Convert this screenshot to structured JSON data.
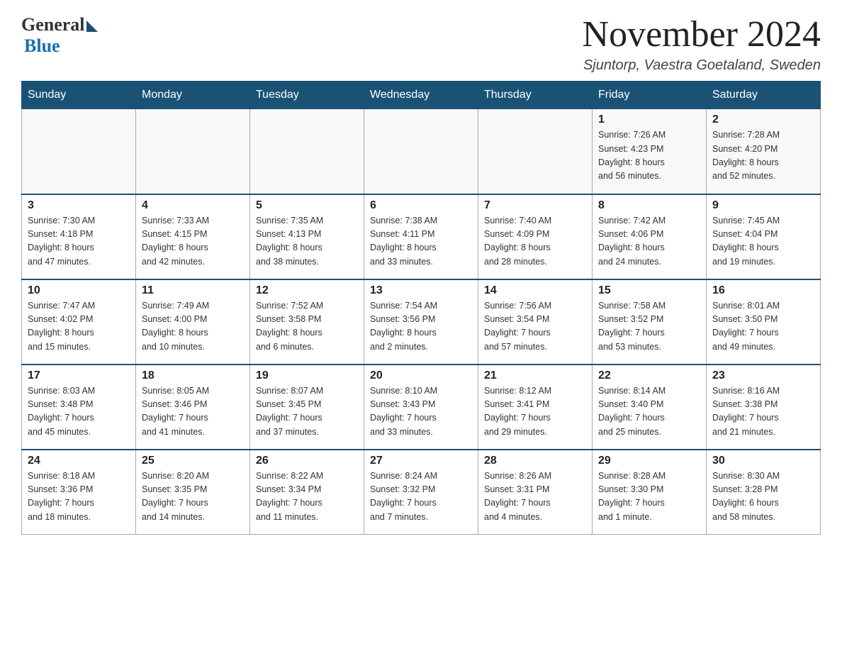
{
  "logo": {
    "general": "General",
    "blue": "Blue"
  },
  "title": "November 2024",
  "location": "Sjuntorp, Vaestra Goetaland, Sweden",
  "days_of_week": [
    "Sunday",
    "Monday",
    "Tuesday",
    "Wednesday",
    "Thursday",
    "Friday",
    "Saturday"
  ],
  "weeks": [
    [
      {
        "day": "",
        "info": ""
      },
      {
        "day": "",
        "info": ""
      },
      {
        "day": "",
        "info": ""
      },
      {
        "day": "",
        "info": ""
      },
      {
        "day": "",
        "info": ""
      },
      {
        "day": "1",
        "info": "Sunrise: 7:26 AM\nSunset: 4:23 PM\nDaylight: 8 hours\nand 56 minutes."
      },
      {
        "day": "2",
        "info": "Sunrise: 7:28 AM\nSunset: 4:20 PM\nDaylight: 8 hours\nand 52 minutes."
      }
    ],
    [
      {
        "day": "3",
        "info": "Sunrise: 7:30 AM\nSunset: 4:18 PM\nDaylight: 8 hours\nand 47 minutes."
      },
      {
        "day": "4",
        "info": "Sunrise: 7:33 AM\nSunset: 4:15 PM\nDaylight: 8 hours\nand 42 minutes."
      },
      {
        "day": "5",
        "info": "Sunrise: 7:35 AM\nSunset: 4:13 PM\nDaylight: 8 hours\nand 38 minutes."
      },
      {
        "day": "6",
        "info": "Sunrise: 7:38 AM\nSunset: 4:11 PM\nDaylight: 8 hours\nand 33 minutes."
      },
      {
        "day": "7",
        "info": "Sunrise: 7:40 AM\nSunset: 4:09 PM\nDaylight: 8 hours\nand 28 minutes."
      },
      {
        "day": "8",
        "info": "Sunrise: 7:42 AM\nSunset: 4:06 PM\nDaylight: 8 hours\nand 24 minutes."
      },
      {
        "day": "9",
        "info": "Sunrise: 7:45 AM\nSunset: 4:04 PM\nDaylight: 8 hours\nand 19 minutes."
      }
    ],
    [
      {
        "day": "10",
        "info": "Sunrise: 7:47 AM\nSunset: 4:02 PM\nDaylight: 8 hours\nand 15 minutes."
      },
      {
        "day": "11",
        "info": "Sunrise: 7:49 AM\nSunset: 4:00 PM\nDaylight: 8 hours\nand 10 minutes."
      },
      {
        "day": "12",
        "info": "Sunrise: 7:52 AM\nSunset: 3:58 PM\nDaylight: 8 hours\nand 6 minutes."
      },
      {
        "day": "13",
        "info": "Sunrise: 7:54 AM\nSunset: 3:56 PM\nDaylight: 8 hours\nand 2 minutes."
      },
      {
        "day": "14",
        "info": "Sunrise: 7:56 AM\nSunset: 3:54 PM\nDaylight: 7 hours\nand 57 minutes."
      },
      {
        "day": "15",
        "info": "Sunrise: 7:58 AM\nSunset: 3:52 PM\nDaylight: 7 hours\nand 53 minutes."
      },
      {
        "day": "16",
        "info": "Sunrise: 8:01 AM\nSunset: 3:50 PM\nDaylight: 7 hours\nand 49 minutes."
      }
    ],
    [
      {
        "day": "17",
        "info": "Sunrise: 8:03 AM\nSunset: 3:48 PM\nDaylight: 7 hours\nand 45 minutes."
      },
      {
        "day": "18",
        "info": "Sunrise: 8:05 AM\nSunset: 3:46 PM\nDaylight: 7 hours\nand 41 minutes."
      },
      {
        "day": "19",
        "info": "Sunrise: 8:07 AM\nSunset: 3:45 PM\nDaylight: 7 hours\nand 37 minutes."
      },
      {
        "day": "20",
        "info": "Sunrise: 8:10 AM\nSunset: 3:43 PM\nDaylight: 7 hours\nand 33 minutes."
      },
      {
        "day": "21",
        "info": "Sunrise: 8:12 AM\nSunset: 3:41 PM\nDaylight: 7 hours\nand 29 minutes."
      },
      {
        "day": "22",
        "info": "Sunrise: 8:14 AM\nSunset: 3:40 PM\nDaylight: 7 hours\nand 25 minutes."
      },
      {
        "day": "23",
        "info": "Sunrise: 8:16 AM\nSunset: 3:38 PM\nDaylight: 7 hours\nand 21 minutes."
      }
    ],
    [
      {
        "day": "24",
        "info": "Sunrise: 8:18 AM\nSunset: 3:36 PM\nDaylight: 7 hours\nand 18 minutes."
      },
      {
        "day": "25",
        "info": "Sunrise: 8:20 AM\nSunset: 3:35 PM\nDaylight: 7 hours\nand 14 minutes."
      },
      {
        "day": "26",
        "info": "Sunrise: 8:22 AM\nSunset: 3:34 PM\nDaylight: 7 hours\nand 11 minutes."
      },
      {
        "day": "27",
        "info": "Sunrise: 8:24 AM\nSunset: 3:32 PM\nDaylight: 7 hours\nand 7 minutes."
      },
      {
        "day": "28",
        "info": "Sunrise: 8:26 AM\nSunset: 3:31 PM\nDaylight: 7 hours\nand 4 minutes."
      },
      {
        "day": "29",
        "info": "Sunrise: 8:28 AM\nSunset: 3:30 PM\nDaylight: 7 hours\nand 1 minute."
      },
      {
        "day": "30",
        "info": "Sunrise: 8:30 AM\nSunset: 3:28 PM\nDaylight: 6 hours\nand 58 minutes."
      }
    ]
  ]
}
